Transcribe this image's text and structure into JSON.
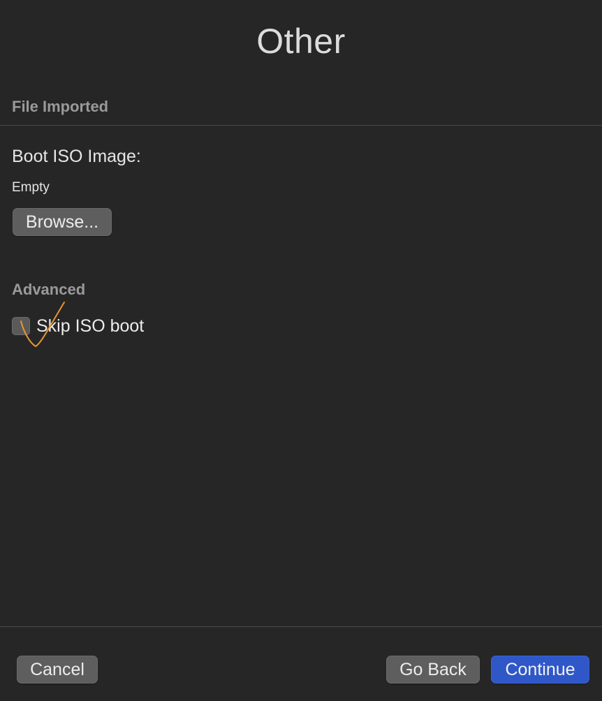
{
  "window": {
    "title": "Other"
  },
  "file_section": {
    "header": "File Imported",
    "boot_iso_label": "Boot ISO Image:",
    "boot_iso_value": "Empty",
    "browse_label": "Browse..."
  },
  "advanced_section": {
    "header": "Advanced",
    "skip_iso_boot_label": "Skip ISO boot",
    "skip_iso_boot_checked": false
  },
  "footer": {
    "cancel_label": "Cancel",
    "go_back_label": "Go Back",
    "continue_label": "Continue"
  },
  "colors": {
    "background": "#262626",
    "primary_button": "#2f57c8",
    "secondary_button": "#5e5e5e",
    "annotation_stroke": "#e8962e"
  },
  "icons": {
    "annotation": "checkmark-scribble-icon"
  }
}
